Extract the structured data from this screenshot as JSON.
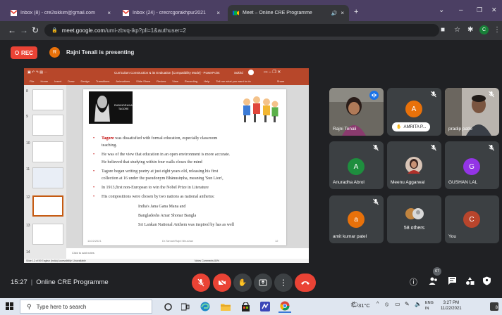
{
  "browser": {
    "tabs": [
      {
        "title": "Inbox (8) - cre2sikkim@gmail.com",
        "close": "×"
      },
      {
        "title": "Inbox (24) - crecrcgorakhpur2021",
        "close": "×"
      },
      {
        "title": "Meet – Online CRE Programme",
        "close": "×"
      }
    ],
    "new_tab": "+",
    "url_domain": "meet.google.com",
    "url_path": "/umi-zbvq-ikp?pli=1&authuser=2",
    "profile_initial": "C",
    "window_controls": {
      "chevron": "⌄",
      "minimize": "–",
      "restore": "❐",
      "close": "✕"
    }
  },
  "meet": {
    "rec_label": "REC",
    "presenter_initial": "R",
    "presenting_text": "Rajni Tenali is presenting",
    "clock": "15:27",
    "separator": "|",
    "meeting_title": "Online CRE Programme",
    "people_count": "67",
    "colors": {
      "red": "#ea4335",
      "tile": "#3c4043"
    }
  },
  "slide": {
    "window_title": "Curriculum Construction & its Evaluation [Compatibility Mode] - PowerPoint",
    "signin": "Sukhd",
    "ribbon": [
      "File",
      "Home",
      "Insert",
      "Draw",
      "Design",
      "Transitions",
      "Animations",
      "Slide Show",
      "Review",
      "View",
      "Recording",
      "Help",
      "Tell me what you want to do",
      "Share"
    ],
    "thumb_numbers": [
      "8",
      "9",
      "10",
      "11",
      "12",
      "13",
      "14"
    ],
    "portrait_caption_1": "RABINDRANATH",
    "portrait_caption_2": "TAGORE",
    "bullets": [
      {
        "lead": "Tagore",
        "rest": " was dissatisfied with formal education, especially classroom",
        "cont": "teaching."
      },
      {
        "lead": "",
        "rest": "He was of the view that education in an open environment is more accurate.",
        "cont": "He believed that studying within four walls closes the mind"
      },
      {
        "lead": "",
        "rest": "Tagore began writing poetry at just eight years old, releasing his first",
        "cont": "collection at 16 under the pseudonym Bhānusiṃha, meaning 'Sun Lion',"
      },
      {
        "lead": "",
        "rest": "In 1913,first non-European to win the Nobel Prize in Literature",
        "cont": ""
      },
      {
        "lead": "",
        "rest": "His compositions were chosen by two nations as national anthems:",
        "cont": ""
      }
    ],
    "anthems": [
      "India's  Jana Gana Mana  and",
      "Bangladeshs Amar Shonar Bangla",
      "Sri Lankan National Anthem was inspired by has as well"
    ],
    "date": "11/22/2021",
    "author": "Dr.Tamah/Rajni Bhushan",
    "page": "12",
    "notes_placeholder": "Click to add notes",
    "status_left": "Slide 12 of 59   English (India)   Accessibility: Unavailable",
    "status_right": "Notes   Comments   80%"
  },
  "participants": [
    {
      "name": "Rajni Tenali",
      "type": "video",
      "speaking": true
    },
    {
      "name": "AMRITA P...",
      "type": "avatar",
      "initial": "A",
      "color": "#e8710a",
      "pill": true
    },
    {
      "name": "pradip patle",
      "type": "video"
    },
    {
      "name": "Anuradha Abrol",
      "type": "avatar",
      "initial": "A",
      "color": "#1e8e3e",
      "muted": true
    },
    {
      "name": "Meenu Aggarwal",
      "type": "photo",
      "muted": true
    },
    {
      "name": "GUSHAN LAL",
      "type": "avatar",
      "initial": "G",
      "color": "#9334e6",
      "muted": true
    },
    {
      "name": "amit kumar patel",
      "type": "avatar",
      "initial": "a",
      "color": "#e8710a",
      "muted": true
    },
    {
      "name": "58 others",
      "type": "group"
    },
    {
      "name": "You",
      "type": "avatar",
      "initial": "C",
      "color": "#b8452c"
    }
  ],
  "taskbar": {
    "search_placeholder": "Type here to search",
    "temperature": "31°C",
    "lang_1": "ENG",
    "lang_2": "IN",
    "time": "3:27 PM",
    "date": "11/22/2021",
    "notification_count": "8"
  }
}
